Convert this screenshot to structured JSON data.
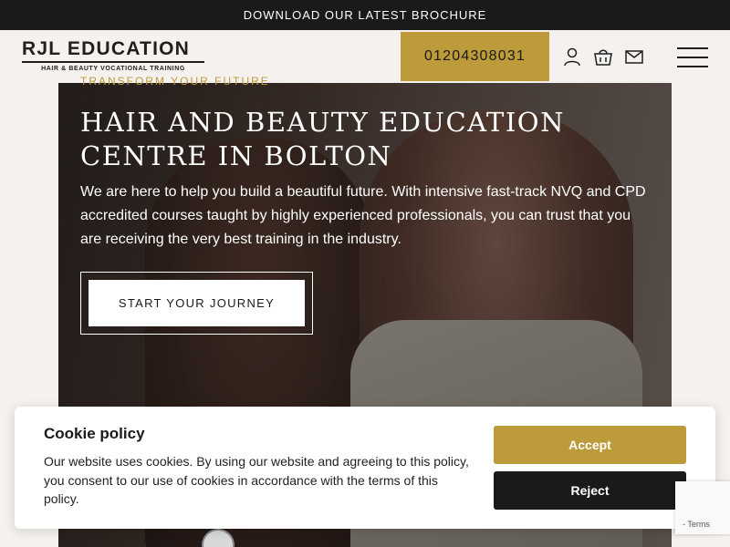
{
  "top_banner": {
    "text": "DOWNLOAD OUR LATEST BROCHURE"
  },
  "header": {
    "logo_main": "RJL EDUCATION",
    "logo_sub": "HAIR & BEAUTY VOCATIONAL TRAINING",
    "phone": "01204308031",
    "icons": [
      "user-icon",
      "basket-icon",
      "mail-icon",
      "menu-icon"
    ]
  },
  "hero": {
    "eyebrow": "TRANSFORM YOUR FUTURE",
    "title": "Hair and Beauty Education Centre in Bolton",
    "text": "We are here to help you build a beautiful future. With intensive fast-track NVQ and CPD accredited courses taught by highly experienced professionals, you can trust that you are receiving the very best training in the industry.",
    "cta": "START YOUR JOURNEY"
  },
  "cookie": {
    "title": "Cookie policy",
    "text": "Our website uses cookies. By using our website and agreeing to this policy, you consent to our use of cookies in accordance with the terms of this policy.",
    "accept": "Accept",
    "reject": "Reject"
  },
  "recaptcha": {
    "text": "- Terms"
  },
  "colors": {
    "gold": "#bd9a3a",
    "dark": "#1a1a1a",
    "background": "#f5f1ee"
  }
}
